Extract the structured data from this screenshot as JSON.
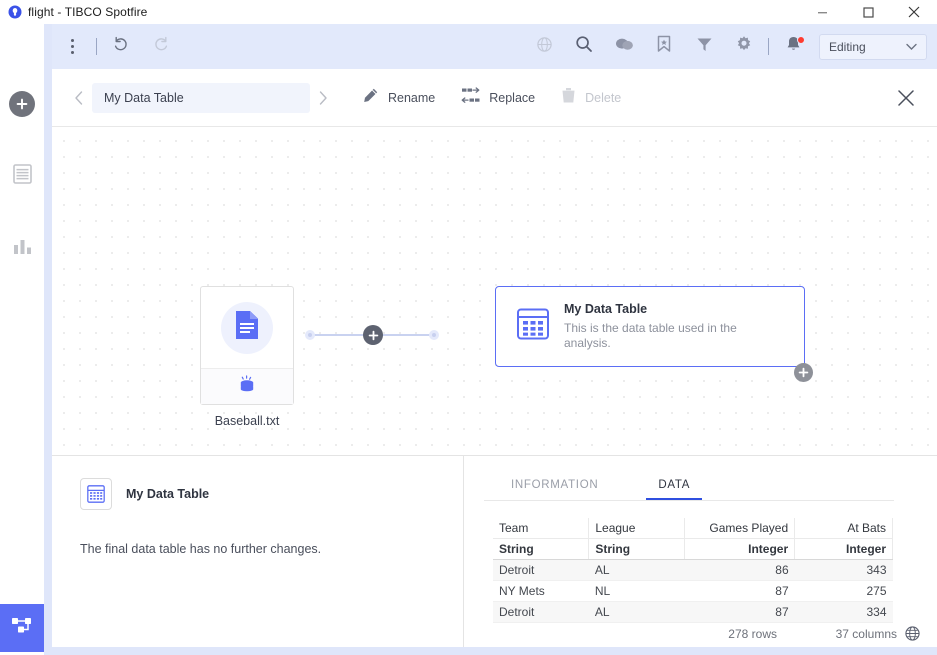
{
  "window": {
    "title": "flight - TIBCO Spotfire",
    "logo_icon": "spotfire-logo-icon",
    "controls": {
      "minimize": "minimize-icon",
      "maximize": "maximize-icon",
      "close": "close-icon"
    }
  },
  "rail": {
    "items": [
      {
        "name": "add",
        "icon": "plus-circle-icon"
      },
      {
        "name": "pages",
        "icon": "list-rows-icon"
      },
      {
        "name": "visualizations",
        "icon": "bar-chart-icon"
      },
      {
        "name": "data-canvas",
        "icon": "node-flow-icon",
        "active": true
      }
    ]
  },
  "toolbar": {
    "menu_icon": "more-vertical-icon",
    "undo_icon": "undo-icon",
    "redo_icon": "redo-icon",
    "right_icons": [
      "globe-icon",
      "search-icon",
      "comments-icon",
      "bookmark-icon",
      "filter-icon",
      "gear-icon"
    ],
    "notifications_icon": "bell-icon",
    "has_notification": true,
    "mode": {
      "label": "Editing",
      "chevron_icon": "chevron-down-icon"
    }
  },
  "actionbar": {
    "prev_icon": "chevron-left-icon",
    "next_icon": "chevron-right-icon",
    "table_name": "My Data Table",
    "rename": {
      "label": "Rename",
      "icon": "pencil-icon",
      "enabled": true
    },
    "replace": {
      "label": "Replace",
      "icon": "replace-icon",
      "enabled": true
    },
    "delete": {
      "label": "Delete",
      "icon": "trash-icon",
      "enabled": false
    },
    "close_icon": "close-icon"
  },
  "canvas": {
    "source_node": {
      "caption": "Baseball.txt",
      "main_icon": "document-icon",
      "footer_icon": "database-icon"
    },
    "connector": {
      "add_icon": "plus-icon"
    },
    "data_table_node": {
      "icon": "table-grid-icon",
      "title": "My Data Table",
      "description": "This is the data table used in the analysis.",
      "add_icon": "plus-icon",
      "selected": true
    }
  },
  "details": {
    "left": {
      "icon": "table-grid-icon",
      "title": "My Data Table",
      "note": "The final data table has no further changes."
    },
    "tabs": [
      {
        "label": "INFORMATION",
        "active": false
      },
      {
        "label": "DATA",
        "active": true
      }
    ],
    "table": {
      "columns": [
        "Team",
        "League",
        "Games Played",
        "At Bats"
      ],
      "types": [
        "String",
        "String",
        "Integer",
        "Integer"
      ],
      "rows": [
        [
          "Detroit",
          "AL",
          "86",
          "343"
        ],
        [
          "NY Mets",
          "NL",
          "87",
          "275"
        ],
        [
          "Detroit",
          "AL",
          "87",
          "334"
        ]
      ]
    },
    "status": {
      "rows": "278 rows",
      "columns": "37 columns",
      "globe_icon": "globe-icon"
    }
  },
  "colors": {
    "accent": "#5b6ef5",
    "tab_underline": "#2f4fe0",
    "toolbar_bg": "#e2e9fb",
    "notification": "#ff3b30"
  }
}
